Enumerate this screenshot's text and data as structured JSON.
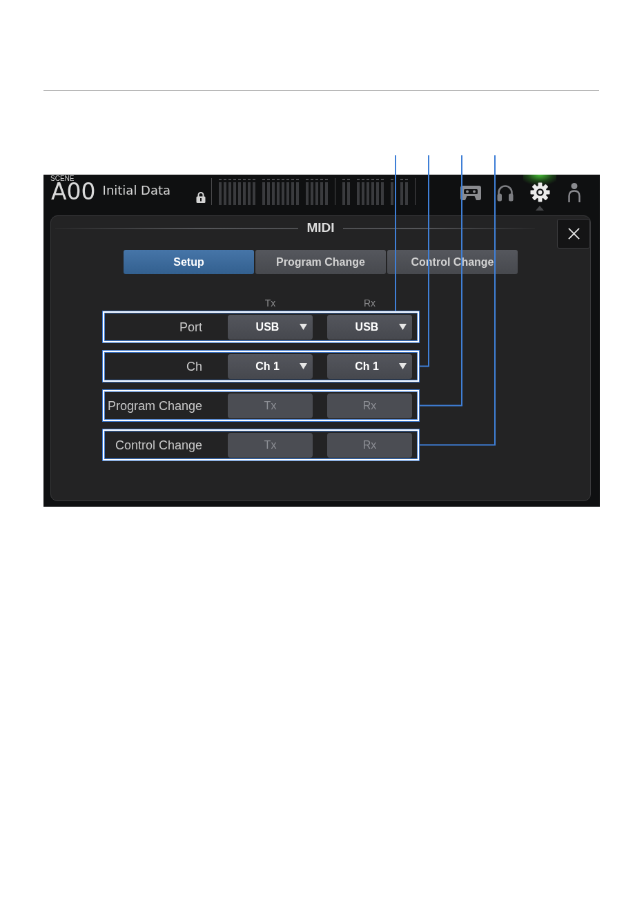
{
  "scene": {
    "label": "SCENE",
    "number": "A00",
    "name": "Initial Data"
  },
  "toolbar": [
    {
      "selected": false
    },
    {
      "selected": false
    },
    {
      "selected": true
    },
    {
      "selected": false
    }
  ],
  "dialog": {
    "title": "MIDI",
    "tabs": [
      {
        "label": "Setup",
        "selected": true
      },
      {
        "label": "Program Change",
        "selected": false
      },
      {
        "label": "Control Change",
        "selected": false
      }
    ],
    "columns": [
      "Tx",
      "Rx"
    ],
    "rows": [
      {
        "kind": "select",
        "label": "Port",
        "callout": true,
        "controls": [
          {
            "value": "USB"
          },
          {
            "value": "USB"
          }
        ]
      },
      {
        "kind": "select",
        "label": "Ch",
        "callout": true,
        "controls": [
          {
            "value": "Ch 1"
          },
          {
            "value": "Ch 1"
          }
        ]
      },
      {
        "kind": "toggle",
        "label": "Program Change",
        "callout": true,
        "controls": [
          {
            "label": "Tx",
            "on": false
          },
          {
            "label": "Rx",
            "on": false
          }
        ]
      },
      {
        "kind": "toggle",
        "label": "Control Change",
        "callout": true,
        "controls": [
          {
            "label": "Tx",
            "on": false
          },
          {
            "label": "Rx",
            "on": false
          }
        ]
      }
    ]
  }
}
